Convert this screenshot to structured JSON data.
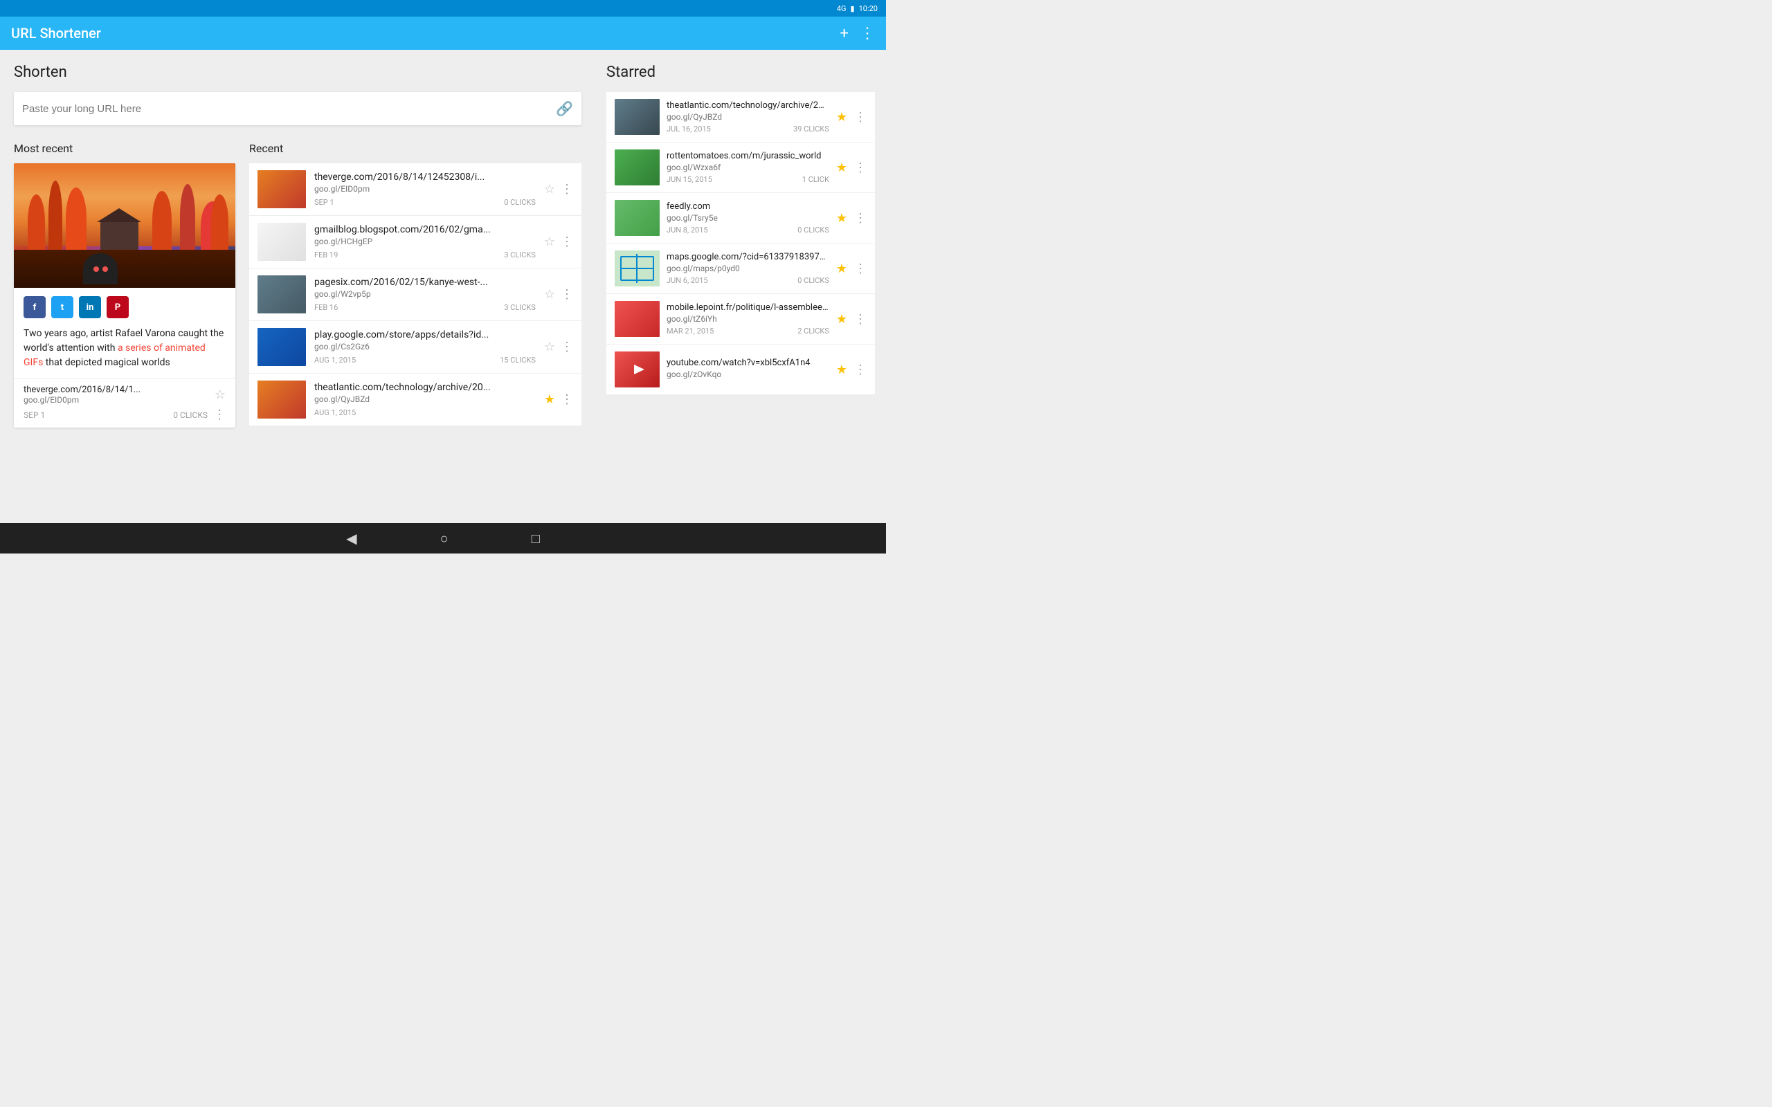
{
  "statusBar": {
    "signal": "4G",
    "battery": "🔋",
    "time": "10:20"
  },
  "appBar": {
    "title": "URL Shortener",
    "addIcon": "+",
    "moreIcon": "⋮"
  },
  "shorten": {
    "title": "Shorten",
    "placeholder": "Paste your long URL here"
  },
  "mostRecent": {
    "title": "Most recent",
    "card": {
      "description1": "Two years ago, artist Rafael Varona caught the world's attention with ",
      "highlight": "a series of animated GIFs",
      "description2": " that depicted magical worlds",
      "url": "theverge.com/2016/8/14/1...",
      "shortUrl": "goo.gl/EID0pm",
      "date": "SEP 1",
      "clicks": "0 CLICKS"
    }
  },
  "recent": {
    "title": "Recent",
    "items": [
      {
        "url": "theverge.com/2016/8/14/12452308/i...",
        "shortUrl": "goo.gl/EID0pm",
        "date": "SEP 1",
        "clicks": "0 CLICKS",
        "starred": false,
        "thumbClass": "recent-thumb-verge"
      },
      {
        "url": "gmailblog.blogspot.com/2016/02/gma...",
        "shortUrl": "goo.gl/HCHgEP",
        "date": "FEB 19",
        "clicks": "3 CLICKS",
        "starred": false,
        "thumbClass": "recent-thumb-gmail"
      },
      {
        "url": "pagesix.com/2016/02/15/kanye-west-...",
        "shortUrl": "goo.gl/W2vp5p",
        "date": "FEB 16",
        "clicks": "3 CLICKS",
        "starred": false,
        "thumbClass": "recent-thumb-pagesix"
      },
      {
        "url": "play.google.com/store/apps/details?id...",
        "shortUrl": "goo.gl/Cs2Gz6",
        "date": "AUG 1, 2015",
        "clicks": "15 CLICKS",
        "starred": false,
        "thumbClass": "recent-thumb-play"
      },
      {
        "url": "theatlantic.com/technology/archive/20...",
        "shortUrl": "goo.gl/QyJBZd",
        "date": "AUG 1, 2015",
        "clicks": "",
        "starred": true,
        "thumbClass": "recent-thumb-atlantic"
      }
    ]
  },
  "starred": {
    "title": "Starred",
    "items": [
      {
        "url": "theatlantic.com/technology/archive/20...",
        "shortUrl": "goo.gl/QyJBZd",
        "date": "JUL 16, 2015",
        "clicks": "39 CLICKS",
        "thumbClass": "starred-thumb-atlantic"
      },
      {
        "url": "rottentomatoes.com/m/jurassic_world",
        "shortUrl": "goo.gl/Wzxa6f",
        "date": "JUN 15, 2015",
        "clicks": "1 CLICK",
        "thumbClass": "starred-thumb-jurassic"
      },
      {
        "url": "feedly.com",
        "shortUrl": "goo.gl/Tsry5e",
        "date": "JUN 8, 2015",
        "clicks": "0 CLICKS",
        "thumbClass": "starred-thumb-feedly"
      },
      {
        "url": "maps.google.com/?cid=613379183973...",
        "shortUrl": "goo.gl/maps/p0yd0",
        "date": "JUN 6, 2015",
        "clicks": "0 CLICKS",
        "thumbClass": "starred-thumb-maps"
      },
      {
        "url": "mobile.lepoint.fr/politique/l-assemblee-...",
        "shortUrl": "goo.gl/tZ6iYh",
        "date": "MAR 21, 2015",
        "clicks": "2 CLICKS",
        "thumbClass": "starred-thumb-lepoint"
      },
      {
        "url": "youtube.com/watch?v=xbl5cxfA1n4",
        "shortUrl": "goo.gl/zOvKqo",
        "date": "",
        "clicks": "",
        "thumbClass": "starred-thumb-youtube"
      }
    ]
  },
  "social": {
    "facebook": "f",
    "twitter": "t",
    "linkedin": "in",
    "pinterest": "P"
  },
  "nav": {
    "back": "◀",
    "home": "○",
    "recent": "□"
  }
}
